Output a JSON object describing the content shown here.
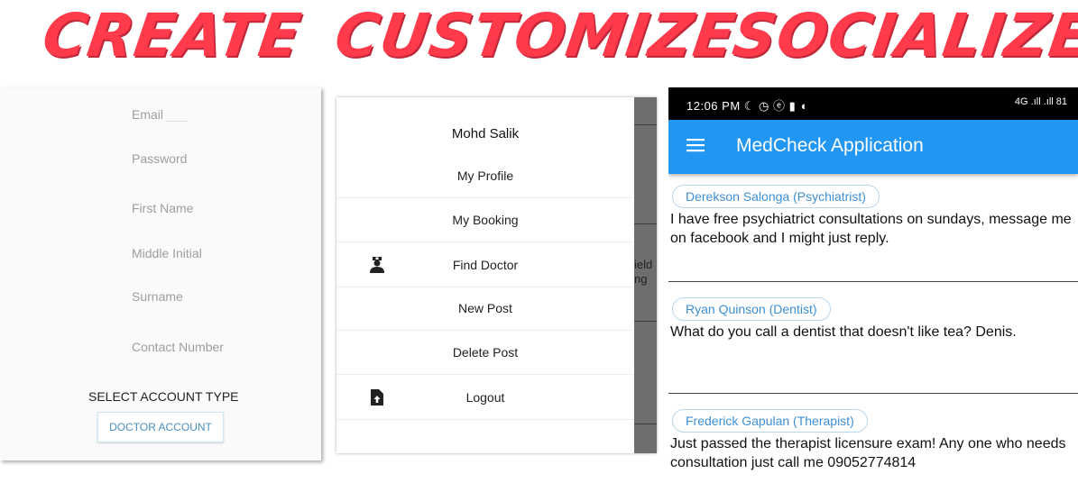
{
  "colors": {
    "accent": "#ff3a4a",
    "appbar": "#2196f3"
  },
  "headlines": {
    "create": "CREATE",
    "customize": "CUSTOMIZE",
    "socialize": "SOCIALIZE"
  },
  "register": {
    "fields": [
      "Email",
      "Password",
      "First Name",
      "Middle Initial",
      "Surname",
      "Contact Number"
    ],
    "account_type_label": "SELECT ACCOUNT TYPE",
    "account_button": "DOCTOR ACCOUNT"
  },
  "drawer": {
    "user_name": "Mohd  Salik",
    "items": [
      {
        "label": "My Profile",
        "icon": ""
      },
      {
        "label": "My Booking",
        "icon": ""
      },
      {
        "label": "Find Doctor",
        "icon": "doctor-icon"
      },
      {
        "label": "New Post",
        "icon": ""
      },
      {
        "label": "Delete Post",
        "icon": ""
      },
      {
        "label": "Logout",
        "icon": "file-upload-icon"
      }
    ],
    "background_fragments": [
      "ield",
      "ng"
    ]
  },
  "phone": {
    "status_time": "12:06 PM",
    "status_right": "4G .ıll .ıll 81",
    "app_title": "MedCheck Application",
    "posts": [
      {
        "author": "Derekson Salonga (Psychiatrist)",
        "text": "I have free psychiatrict consultations on sundays, message me on facebook and I might just reply."
      },
      {
        "author": "Ryan Quinson (Dentist)",
        "text": "What do you call a dentist that doesn't like tea? Denis."
      },
      {
        "author": "Frederick Gapulan (Therapist)",
        "text": "Just passed the therapist licensure exam! Any one who needs consultation just call me 09052774814"
      }
    ]
  }
}
